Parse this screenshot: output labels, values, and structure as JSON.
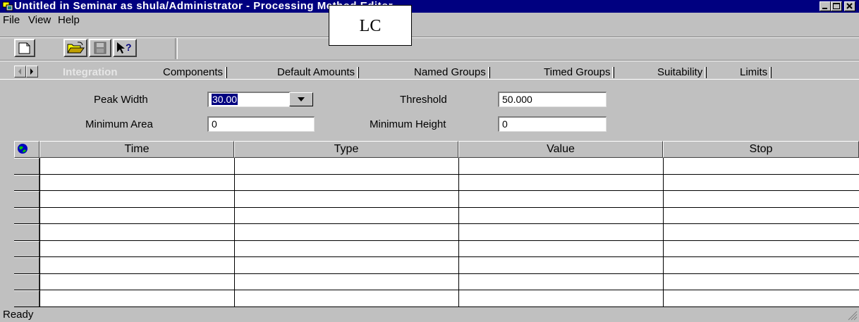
{
  "window": {
    "title": "Untitled in Seminar as shula/Administrator - Processing Method Editor",
    "overlay_label": "LC",
    "controls": [
      "minimize-icon",
      "maximize-icon",
      "close-icon"
    ],
    "title_bar_color": "#000080"
  },
  "menu": {
    "file": "File",
    "view": "View",
    "help": "Help"
  },
  "toolbar": {
    "buttons": [
      "new-document-icon",
      "open-folder-icon",
      "save-disk-icon",
      "context-help-icon"
    ]
  },
  "tabs": {
    "items": [
      "Integration",
      "Components",
      "Default Amounts",
      "Named Groups",
      "Timed Groups",
      "Suitability",
      "Limits"
    ],
    "active": "Integration"
  },
  "params": {
    "peak_width_label": "Peak Width",
    "peak_width_value": "30.00",
    "threshold_label": "Threshold",
    "threshold_value": "50.000",
    "min_area_label": "Minimum Area",
    "min_area_value": "0",
    "min_height_label": "Minimum Height",
    "min_height_value": "0"
  },
  "table": {
    "corner_icon": "globe-icon",
    "columns": [
      "Time",
      "Type",
      "Value",
      "Stop"
    ],
    "empty_rows": 9
  },
  "status": {
    "text": "Ready"
  }
}
